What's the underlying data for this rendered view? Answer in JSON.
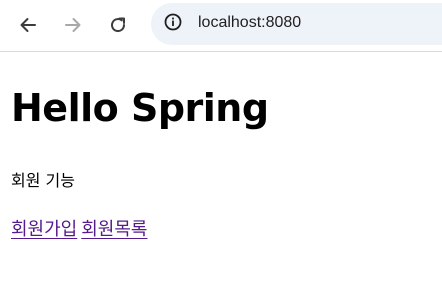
{
  "browser": {
    "back_icon": "arrow-left-icon",
    "forward_icon": "arrow-right-icon",
    "reload_icon": "reload-icon",
    "site_info_icon": "info-icon",
    "url": "localhost:8080"
  },
  "page": {
    "title": "Hello Spring",
    "feature_label": "회원 기능",
    "links": {
      "signup": "회원가입",
      "member_list": "회원목록"
    },
    "link_color": "#551a8b"
  }
}
